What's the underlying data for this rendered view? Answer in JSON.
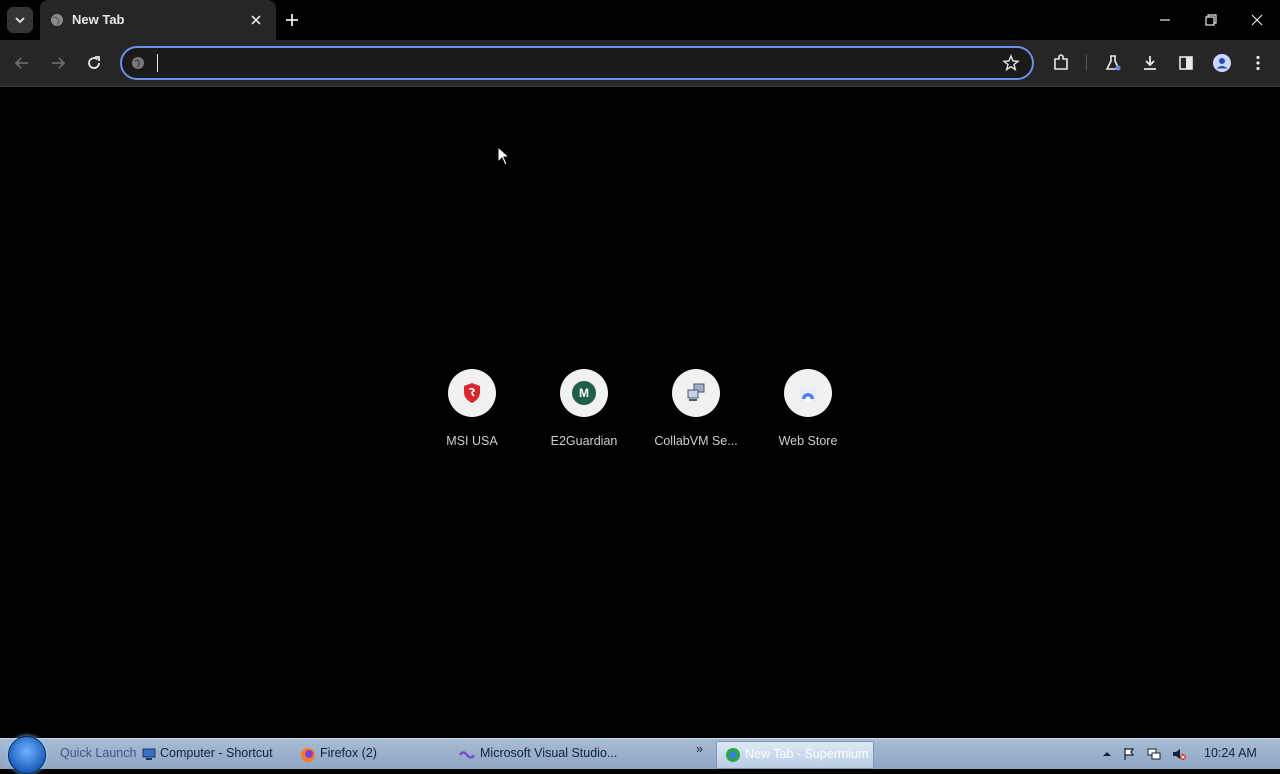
{
  "tabs": [
    {
      "title": "New Tab"
    }
  ],
  "omnibox": {
    "value": "",
    "placeholder": ""
  },
  "shortcuts": [
    {
      "label": "MSI USA",
      "icon": "msi-shield-icon"
    },
    {
      "label": "E2Guardian",
      "icon": "letter-m-icon",
      "letter": "M"
    },
    {
      "label": "CollabVM Se...",
      "icon": "collabvm-computer-icon"
    },
    {
      "label": "Web Store",
      "icon": "web-store-icon"
    }
  ],
  "taskbar": {
    "quick_launch_label": "Quick Launch",
    "items": [
      {
        "label": "Computer - Shortcut"
      },
      {
        "label": "Firefox (2)"
      },
      {
        "label": "Microsoft Visual Studio..."
      },
      {
        "label": "New Tab - Supermium",
        "active": true
      }
    ],
    "overflow_label": "»",
    "clock": "10:24 AM"
  },
  "colors": {
    "accent": "#6d8fe8",
    "toolbar_bg": "#262626",
    "page_bg": "#000000",
    "taskbar_bg": "#9ab0cc"
  }
}
